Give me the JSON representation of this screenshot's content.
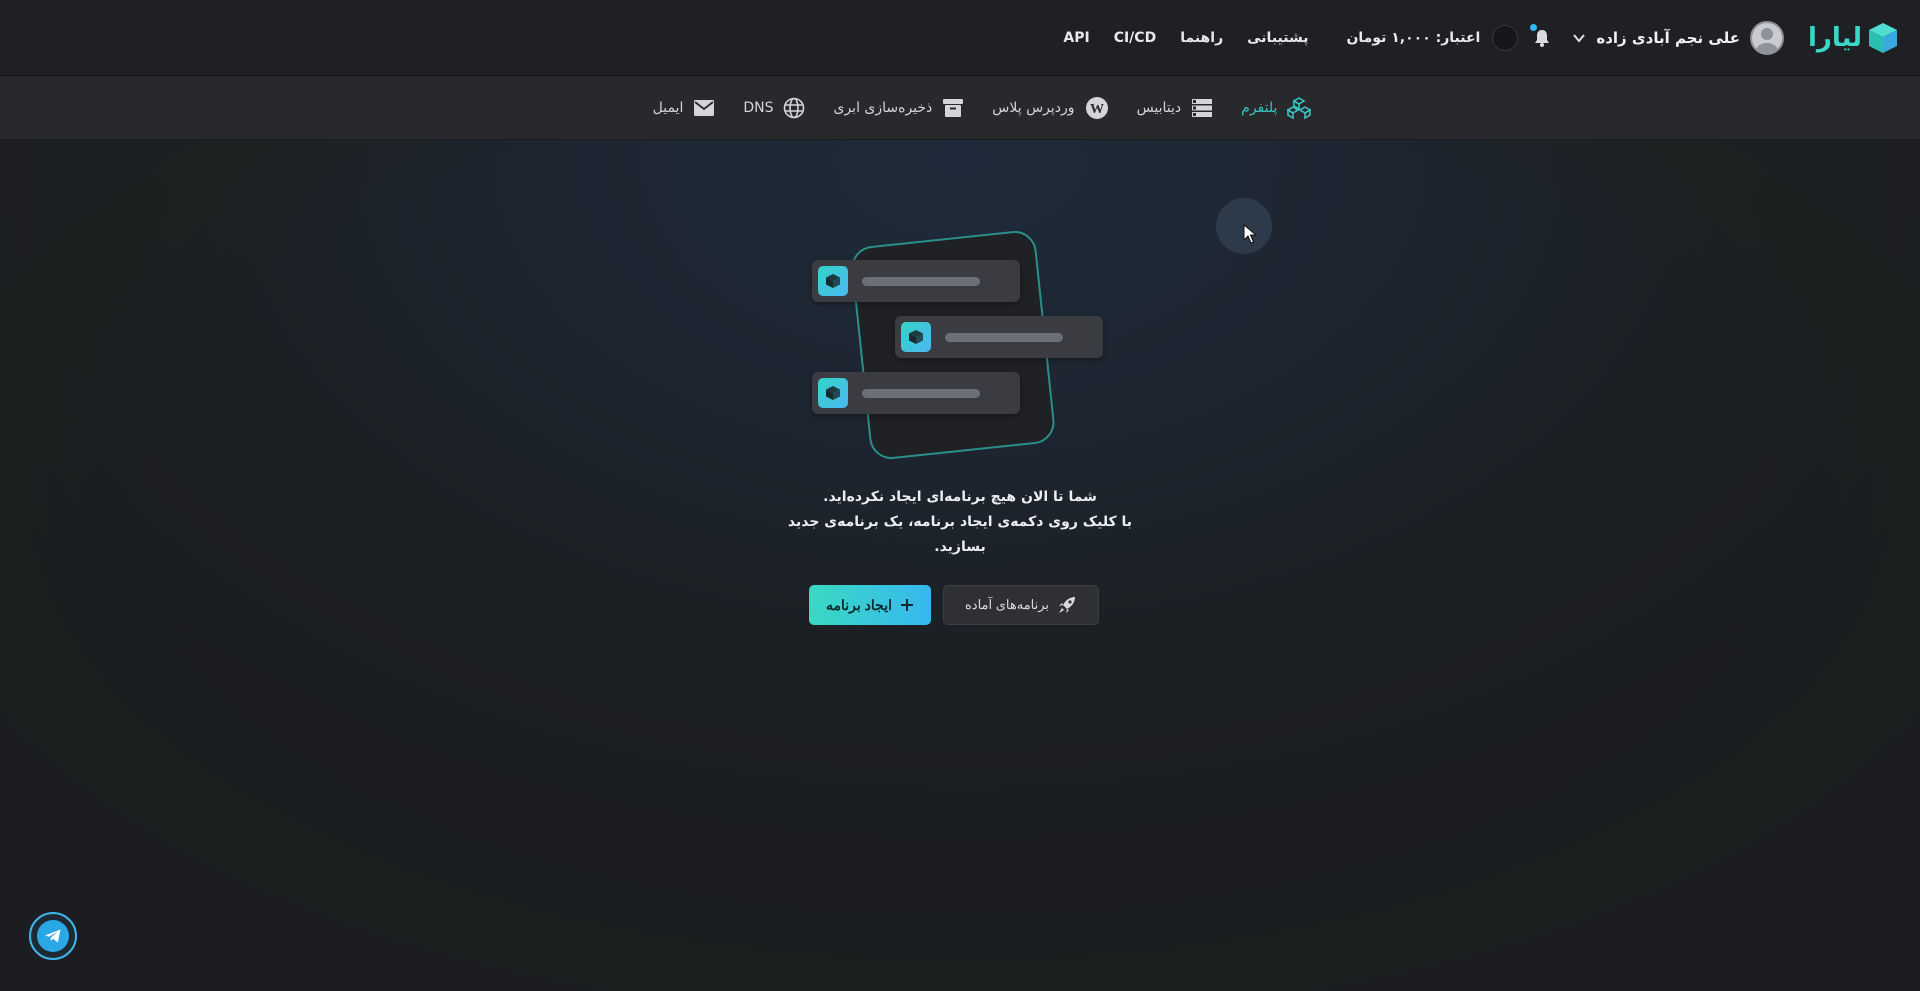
{
  "header": {
    "logo_text": "لیارا",
    "user_name": "علی نجم آبادی زاده",
    "credit": "اعتبار: ۱,۰۰۰ تومان",
    "links": [
      "پشتیبانی",
      "راهنما",
      "CI/CD",
      "API"
    ]
  },
  "services": [
    {
      "label": "پلتفرم",
      "icon": "platform-icon",
      "active": true
    },
    {
      "label": "دیتابیس",
      "icon": "database-icon",
      "active": false
    },
    {
      "label": "وردپرس پلاس",
      "icon": "wordpress-icon",
      "active": false
    },
    {
      "label": "ذخیره‌سازی ابری",
      "icon": "storage-icon",
      "active": false
    },
    {
      "label": "DNS",
      "icon": "globe-icon",
      "active": false
    },
    {
      "label": "ایمیل",
      "icon": "mail-icon",
      "active": false
    }
  ],
  "empty_state": {
    "line1": "شما تا الان هیچ برنامه‌ای ایجاد نکرده‌اید.",
    "line2": "با کلیک روی دکمه‌ی ایجاد برنامه، یک برنامه‌ی جدید",
    "line3": "بسازید.",
    "create_label": "ایجاد برنامه",
    "ready_label": "برنامه‌های آماده"
  },
  "colors": {
    "accent": "#37c5c0",
    "background": "#1b1d20",
    "header": "#1e2023",
    "nav": "#27292d"
  }
}
